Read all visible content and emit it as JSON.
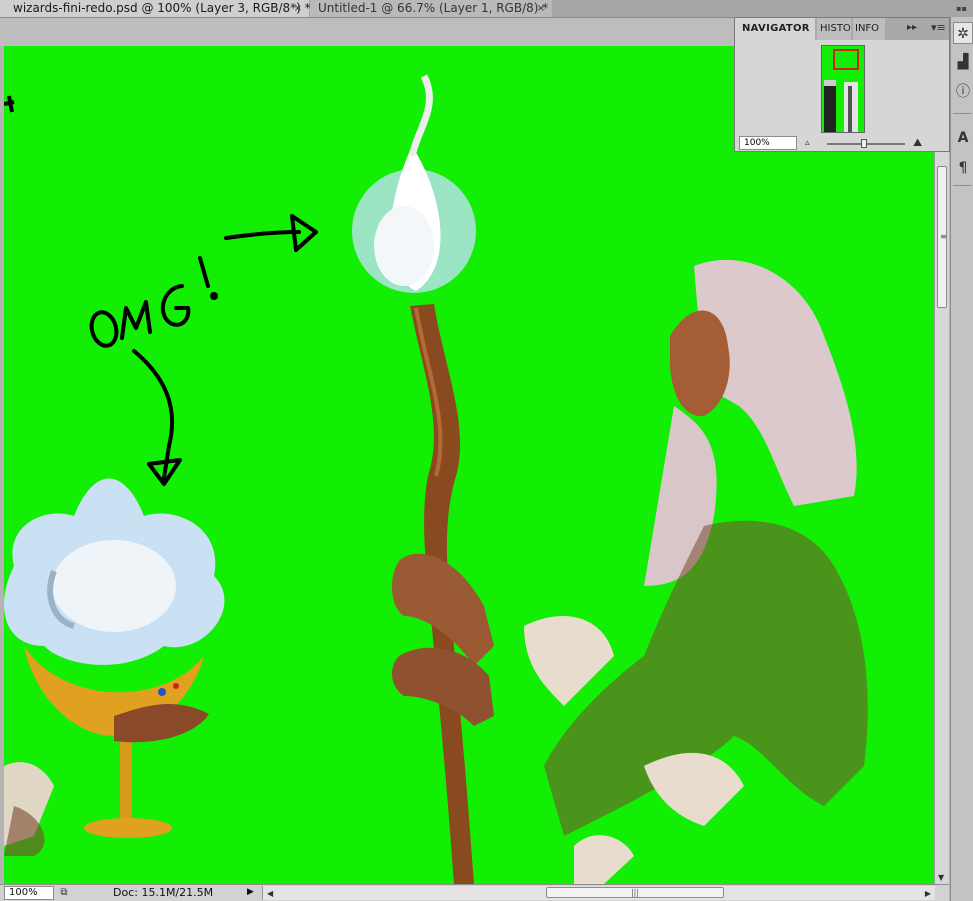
{
  "tabs": [
    {
      "label": "wizards-fini-redo.psd @ 100% (Layer 3, RGB/8*) *",
      "active": true
    },
    {
      "label": "Untitled-1 @ 66.7% (Layer 1, RGB/8) *",
      "active": false
    }
  ],
  "tab_close_glyph": "×",
  "canvas": {
    "background_color": "#12ee04",
    "annotation_text": "OMG!"
  },
  "status": {
    "zoom": "100%",
    "doc_info": "Doc: 15.1M/21.5M"
  },
  "navigator": {
    "tabs": [
      "NAVIGATOR",
      "HISTO",
      "INFO"
    ],
    "zoom": "100%",
    "zoom_level_percent": 100
  },
  "right_strip": {
    "icons": [
      "navigator-icon",
      "histogram-icon",
      "info-icon",
      "character-icon",
      "paragraph-icon"
    ]
  }
}
